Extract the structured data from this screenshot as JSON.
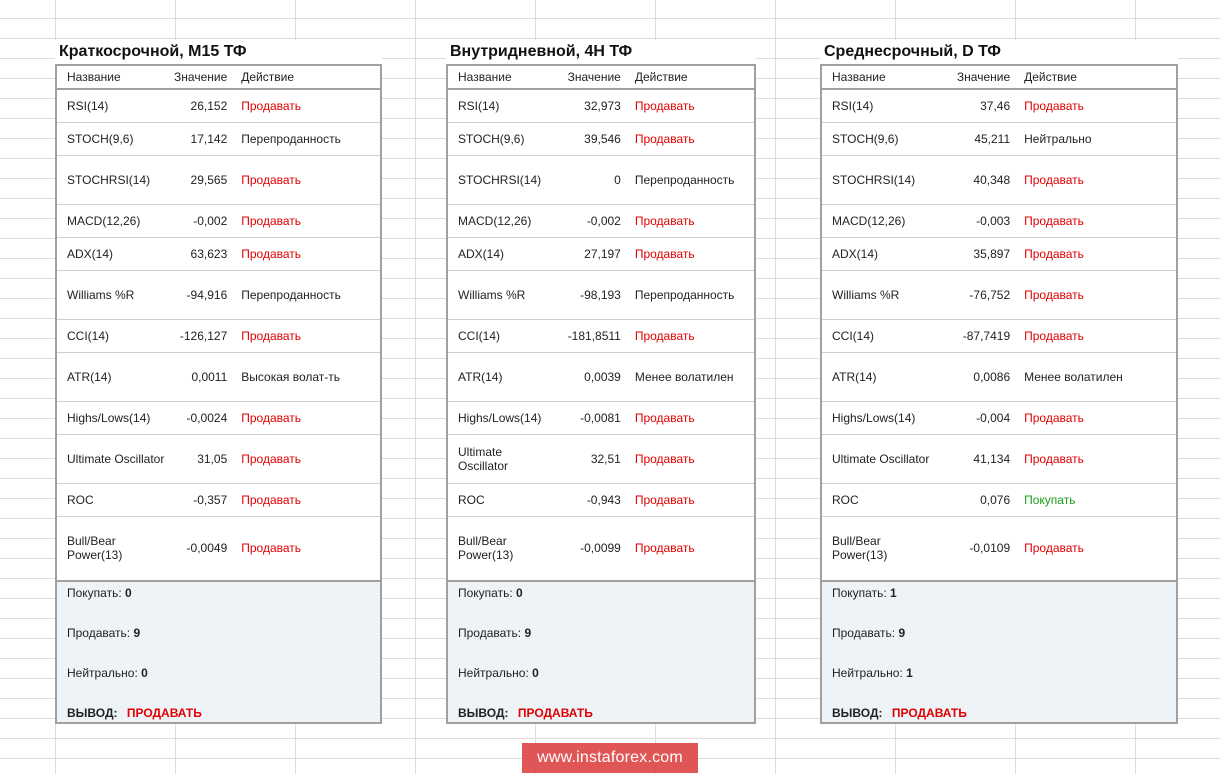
{
  "headers": {
    "name": "Название",
    "value": "Значение",
    "action": "Действие"
  },
  "summary_labels": {
    "buy": "Покупать:",
    "sell": "Продавать:",
    "neutral": "Нейтрально:",
    "verdict": "ВЫВОД:"
  },
  "panels": [
    {
      "title": "Краткосрочной, M15 ТФ",
      "rows": [
        {
          "name": "RSI(14)",
          "value": "26,152",
          "action": "Продавать",
          "tone": "sell"
        },
        {
          "name": "STOCH(9,6)",
          "value": "17,142",
          "action": "Перепроданность",
          "tone": "neutral"
        },
        {
          "name": "STOCHRSI(14)",
          "value": "29,565",
          "action": "Продавать",
          "tone": "sell"
        },
        {
          "name": "MACD(12,26)",
          "value": "-0,002",
          "action": "Продавать",
          "tone": "sell"
        },
        {
          "name": "ADX(14)",
          "value": "63,623",
          "action": "Продавать",
          "tone": "sell"
        },
        {
          "name": "Williams %R",
          "value": "-94,916",
          "action": "Перепроданность",
          "tone": "neutral"
        },
        {
          "name": "CCI(14)",
          "value": "-126,127",
          "action": "Продавать",
          "tone": "sell"
        },
        {
          "name": "ATR(14)",
          "value": "0,0011",
          "action": "Высокая волат-ть",
          "tone": "neutral"
        },
        {
          "name": "Highs/Lows(14)",
          "value": "-0,0024",
          "action": "Продавать",
          "tone": "sell"
        },
        {
          "name": "Ultimate Oscillator",
          "value": "31,05",
          "action": "Продавать",
          "tone": "sell"
        },
        {
          "name": "ROC",
          "value": "-0,357",
          "action": "Продавать",
          "tone": "sell"
        },
        {
          "name": "Bull/Bear Power(13)",
          "value": "-0,0049",
          "action": "Продавать",
          "tone": "sell"
        }
      ],
      "summary": {
        "buy": "0",
        "sell": "9",
        "neutral": "0",
        "verdict": "ПРОДАВАТЬ"
      }
    },
    {
      "title": "Внутридневной, 4H ТФ",
      "rows": [
        {
          "name": "RSI(14)",
          "value": "32,973",
          "action": "Продавать",
          "tone": "sell"
        },
        {
          "name": "STOCH(9,6)",
          "value": "39,546",
          "action": "Продавать",
          "tone": "sell"
        },
        {
          "name": "STOCHRSI(14)",
          "value": "0",
          "action": "Перепроданность",
          "tone": "neutral"
        },
        {
          "name": "MACD(12,26)",
          "value": "-0,002",
          "action": "Продавать",
          "tone": "sell"
        },
        {
          "name": "ADX(14)",
          "value": "27,197",
          "action": "Продавать",
          "tone": "sell"
        },
        {
          "name": "Williams %R",
          "value": "-98,193",
          "action": "Перепроданность",
          "tone": "neutral"
        },
        {
          "name": "CCI(14)",
          "value": "-181,8511",
          "action": "Продавать",
          "tone": "sell"
        },
        {
          "name": "ATR(14)",
          "value": "0,0039",
          "action": "Менее волатилен",
          "tone": "neutral"
        },
        {
          "name": "Highs/Lows(14)",
          "value": "-0,0081",
          "action": "Продавать",
          "tone": "sell"
        },
        {
          "name": "Ultimate Oscillator",
          "value": "32,51",
          "action": "Продавать",
          "tone": "sell"
        },
        {
          "name": "ROC",
          "value": "-0,943",
          "action": "Продавать",
          "tone": "sell"
        },
        {
          "name": "Bull/Bear Power(13)",
          "value": "-0,0099",
          "action": "Продавать",
          "tone": "sell"
        }
      ],
      "summary": {
        "buy": "0",
        "sell": "9",
        "neutral": "0",
        "verdict": "ПРОДАВАТЬ"
      }
    },
    {
      "title": "Среднесрочный, D ТФ",
      "rows": [
        {
          "name": "RSI(14)",
          "value": "37,46",
          "action": "Продавать",
          "tone": "sell"
        },
        {
          "name": "STOCH(9,6)",
          "value": "45,211",
          "action": "Нейтрально",
          "tone": "neutral"
        },
        {
          "name": "STOCHRSI(14)",
          "value": "40,348",
          "action": "Продавать",
          "tone": "sell"
        },
        {
          "name": "MACD(12,26)",
          "value": "-0,003",
          "action": "Продавать",
          "tone": "sell"
        },
        {
          "name": "ADX(14)",
          "value": "35,897",
          "action": "Продавать",
          "tone": "sell"
        },
        {
          "name": "Williams %R",
          "value": "-76,752",
          "action": "Продавать",
          "tone": "sell"
        },
        {
          "name": "CCI(14)",
          "value": "-87,7419",
          "action": "Продавать",
          "tone": "sell"
        },
        {
          "name": "ATR(14)",
          "value": "0,0086",
          "action": "Менее волатилен",
          "tone": "neutral"
        },
        {
          "name": "Highs/Lows(14)",
          "value": "-0,004",
          "action": "Продавать",
          "tone": "sell"
        },
        {
          "name": "Ultimate Oscillator",
          "value": "41,134",
          "action": "Продавать",
          "tone": "sell"
        },
        {
          "name": "ROC",
          "value": "0,076",
          "action": "Покупать",
          "tone": "buy"
        },
        {
          "name": "Bull/Bear Power(13)",
          "value": "-0,0109",
          "action": "Продавать",
          "tone": "sell"
        }
      ],
      "summary": {
        "buy": "1",
        "sell": "9",
        "neutral": "1",
        "verdict": "ПРОДАВАТЬ"
      }
    }
  ],
  "watermark": "www.instaforex.com"
}
